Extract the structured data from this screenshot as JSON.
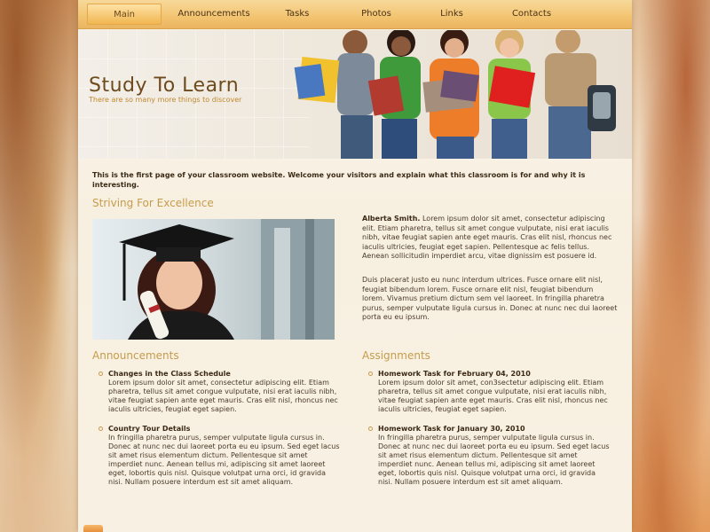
{
  "nav": {
    "items": [
      "Main",
      "Announcements",
      "Tasks",
      "Photos",
      "Links",
      "Contacts"
    ],
    "active_index": 0
  },
  "header": {
    "title": "Study To Learn",
    "tagline": "There are so many more things to discover"
  },
  "intro": "This is the first page of your classroom website. Welcome your visitors and explain what this classroom is for and why it is interesting.",
  "excellence": {
    "heading": "Striving For Excellence",
    "bio_name": "Alberta Smith.",
    "bio_p1": " Lorem ipsum dolor sit amet, consectetur adipiscing elit. Etiam pharetra, tellus sit amet congue vulputate, nisi erat iaculis nibh, vitae feugiat sapien ante eget mauris. Cras elit nisl, rhoncus nec iaculis ultricies, feugiat eget sapien. Pellentesque ac felis tellus. Aenean sollicitudin imperdiet arcu, vitae dignissim est posuere id.",
    "bio_p2": "Duis placerat justo eu nunc interdum ultrices. Fusce ornare elit nisl, feugiat bibendum lorem. Fusce ornare elit nisl, feugiat bibendum lorem. Vivamus pretium dictum sem vel laoreet. In fringilla pharetra purus, semper vulputate ligula cursus in. Donec at nunc nec dui laoreet porta eu eu ipsum."
  },
  "announcements": {
    "heading": "Announcements",
    "items": [
      {
        "title": "Changes in the Class Schedule",
        "text": "Lorem ipsum dolor sit amet, consectetur adipiscing elit. Etiam pharetra, tellus sit amet congue vulputate, nisi erat iaculis nibh, vitae feugiat sapien ante eget mauris. Cras elit nisl, rhoncus nec iaculis ultricies, feugiat eget sapien."
      },
      {
        "title": "Country Tour Details",
        "text": "In fringilla pharetra purus, semper vulputate ligula cursus in. Donec at nunc nec dui laoreet porta eu eu ipsum. Sed eget lacus sit amet risus elementum dictum. Pellentesque sit amet imperdiet nunc. Aenean tellus mi, adipiscing sit amet laoreet eget, lobortis quis nisl. Quisque volutpat urna orci, id gravida nisi. Nullam posuere interdum est sit amet aliquam."
      }
    ]
  },
  "assignments": {
    "heading": "Assignments",
    "items": [
      {
        "title": "Homework Task for February 04, 2010",
        "text": "Lorem ipsum dolor sit amet, con3sectetur adipiscing elit. Etiam pharetra, tellus sit amet congue vulputate, nisi erat iaculis nibh, vitae feugiat sapien ante eget mauris. Cras elit nisl, rhoncus nec iaculis ultricies, feugiat eget sapien."
      },
      {
        "title": "Homework Task for January 30, 2010",
        "text": "In fringilla pharetra purus, semper vulputate ligula cursus in. Donec at nunc nec dui laoreet porta eu eu ipsum. Sed eget lacus sit amet risus elementum dictum. Pellentesque sit amet imperdiet nunc. Aenean tellus mi, adipiscing sit amet laoreet eget, lobortis quis nisl. Quisque volutpat urna orci, id gravida nisi. Nullam posuere interdum est sit amet aliquam."
      }
    ]
  },
  "icons": {
    "rss": "rss-icon"
  },
  "colors": {
    "accent": "#c59c4c",
    "nav_gold": "#f3c471",
    "title_brown": "#6e4b1d"
  }
}
